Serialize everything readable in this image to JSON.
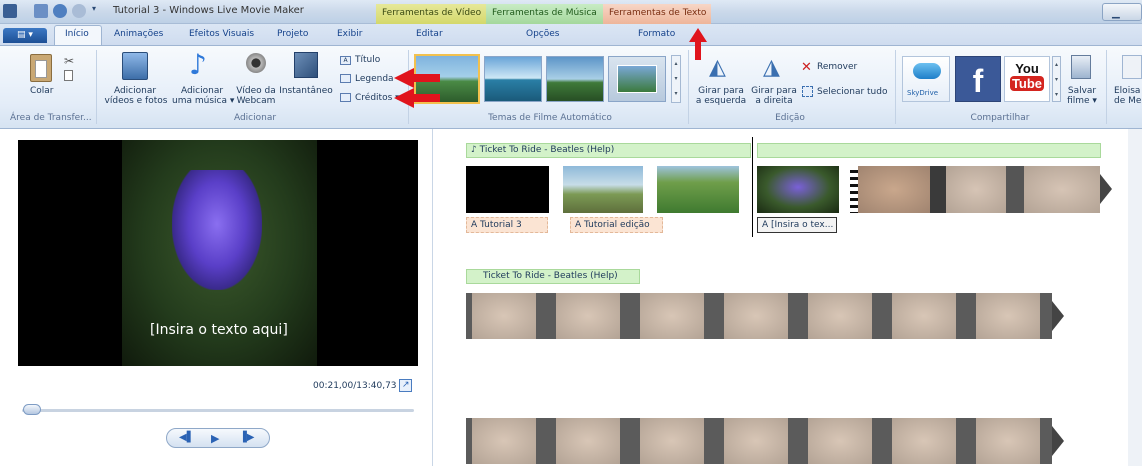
{
  "window": {
    "title": "Tutorial 3 - Windows Live Movie Maker",
    "context_tabs": {
      "video": "Ferramentas de Vídeo",
      "musica": "Ferramentas de Música",
      "texto": "Ferramentas de Texto"
    },
    "tabs": {
      "inicio": "Início",
      "animacoes": "Animações",
      "efeitos": "Efeitos Visuais",
      "projeto": "Projeto",
      "exibir": "Exibir",
      "editar": "Editar",
      "opcoes": "Opções",
      "formato": "Formato"
    }
  },
  "ribbon": {
    "clipboard": {
      "colar": "Colar",
      "group": "Área de Transfer..."
    },
    "add": {
      "adicionar_videos_1": "Adicionar",
      "adicionar_videos_2": "vídeos e fotos",
      "adicionar_musica_1": "Adicionar",
      "adicionar_musica_2": "uma música ▾",
      "video_webcam_1": "Vídeo da",
      "video_webcam_2": "Webcam",
      "instantaneo": "Instantâneo",
      "titulo": "Título",
      "legenda": "Legenda",
      "creditos": "Créditos ▾",
      "group": "Adicionar"
    },
    "themes": {
      "group": "Temas de Filme Automático"
    },
    "edit": {
      "girar_esq_1": "Girar para",
      "girar_esq_2": "a esquerda",
      "girar_dir_1": "Girar para",
      "girar_dir_2": "a direita",
      "remover": "Remover",
      "selecionar_tudo": "Selecionar tudo",
      "group": "Edição"
    },
    "share": {
      "skydrive": "SkyDrive",
      "youtube_1": "You",
      "youtube_2": "Tube",
      "salvar_1": "Salvar",
      "salvar_2": "filme ▾",
      "eloisa_1": "Eloisa",
      "eloisa_2": "de Me",
      "group": "Compartilhar"
    }
  },
  "preview": {
    "caption": "[Insira o texto aqui]",
    "time": "00:21,00/13:40,73"
  },
  "timeline": {
    "music_track_1": "♪ Ticket To Ride - Beatles (Help)",
    "music_track_2": "Ticket To Ride - Beatles (Help)",
    "text_clips": [
      "A Tutorial 3",
      "A Tutorial edição",
      "A [Insira o tex..."
    ]
  },
  "colors": {
    "accent": "#1d4f95",
    "ctx_video": "#d4d86b",
    "ctx_musica": "#a4d89c",
    "ctx_texto": "#eeb59a",
    "annotation_arrow": "#e0141c"
  }
}
